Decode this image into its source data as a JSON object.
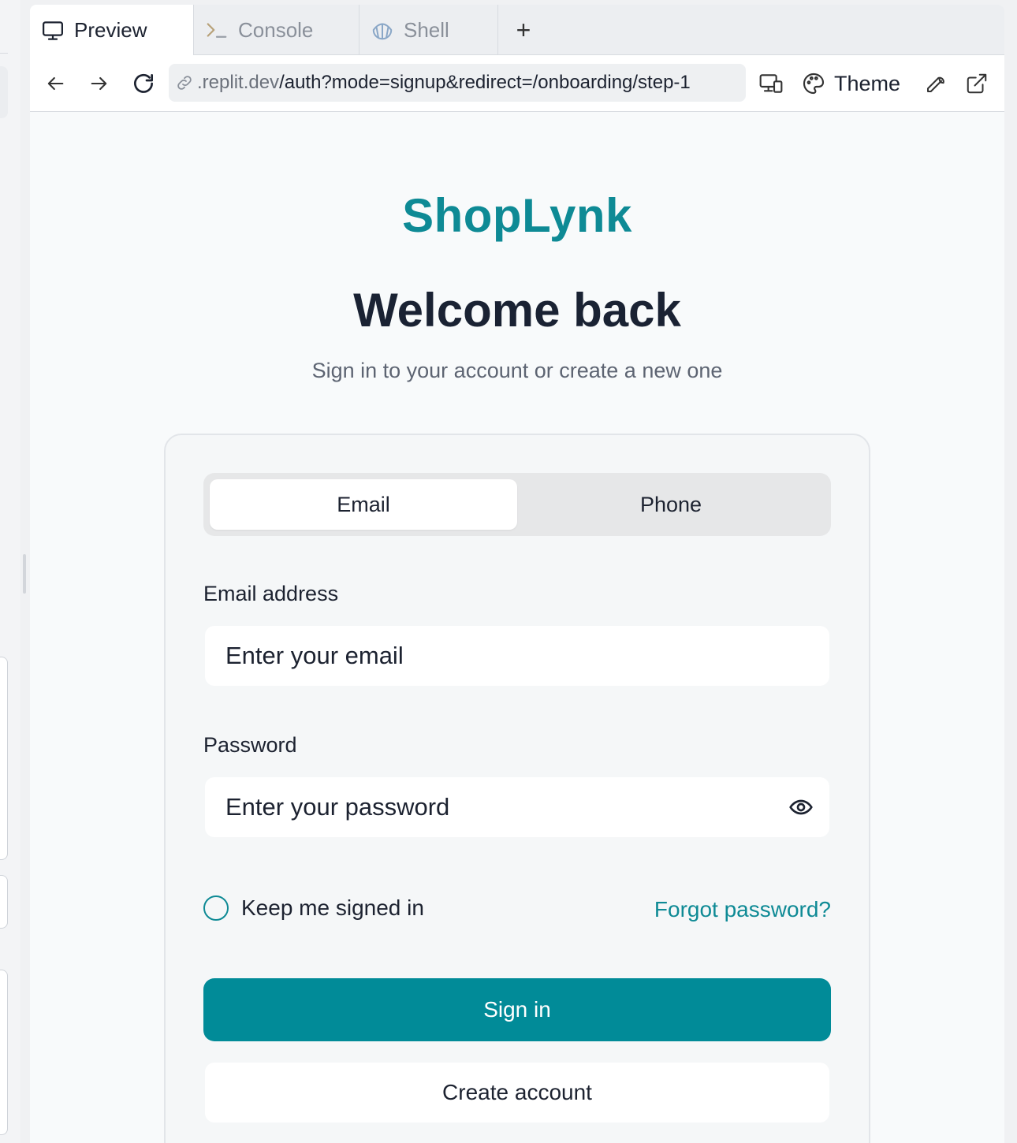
{
  "tabs": {
    "preview": "Preview",
    "console": "Console",
    "shell": "Shell",
    "add": "+"
  },
  "urlbar": {
    "host": ".replit.dev",
    "path": "/auth?mode=signup&redirect=/onboarding/step-1",
    "theme_label": "Theme"
  },
  "page": {
    "brand": "ShopLynk",
    "title": "Welcome back",
    "subtitle": "Sign in to your account or create a new one"
  },
  "auth": {
    "tab_email": "Email",
    "tab_phone": "Phone",
    "selected_tab": "Email",
    "email_label": "Email address",
    "email_placeholder": "Enter your email",
    "password_label": "Password",
    "password_placeholder": "Enter your password",
    "remember_label": "Keep me signed in",
    "remember_checked": false,
    "forgot_label": "Forgot password?",
    "signin_label": "Sign in",
    "create_label": "Create account"
  },
  "colors": {
    "brand": "#0e8a95",
    "primary_button": "#018b98",
    "heading": "#1a2233"
  },
  "icons": [
    "monitor-icon",
    "terminal-icon",
    "shell-icon",
    "plus-icon",
    "back-arrow-icon",
    "forward-arrow-icon",
    "reload-icon",
    "link-icon",
    "devices-icon",
    "palette-icon",
    "wrench-icon",
    "external-link-icon",
    "eye-icon"
  ]
}
